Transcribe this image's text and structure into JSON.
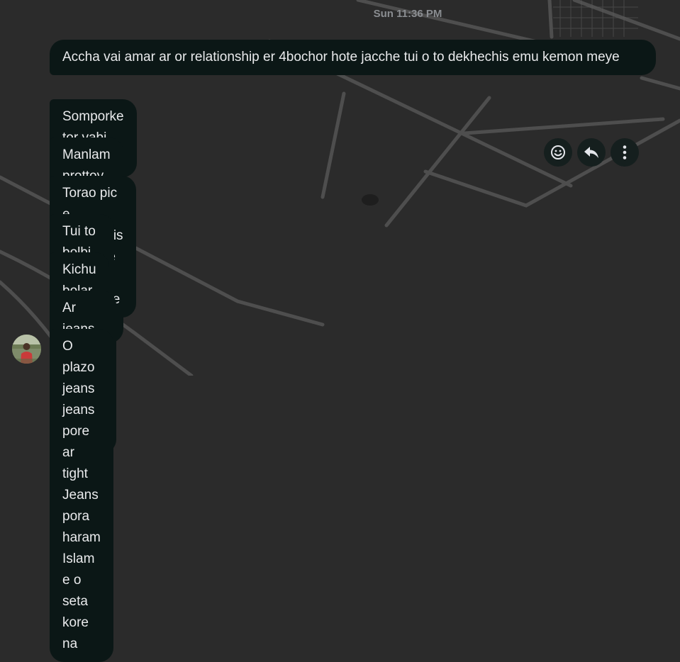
{
  "conversation": {
    "timestamp": "Sun 11:36 PM",
    "messages": [
      {
        "text": "Accha vai amar ar or relationship er 4bochor hote jacche tui o to dekhechis emu kemon meye"
      },
      {
        "text": "Somporke tor vabi hoi"
      },
      {
        "text": "Manlam prottoy boleche tui bolte parti na je emu valo or dressup kemon"
      },
      {
        "text": "Torao pic e dekhechis oi kivabe chola Fera kore"
      },
      {
        "text": "Tui to bolbi na ulta aro eisob niye gossip e korbi"
      },
      {
        "text": "Kichu bolar nai vai"
      },
      {
        "text": "Ar jeans er kotha jeita bolchili tora"
      },
      {
        "text": "O plazo jeans jeans pore ar tight Jeans pora haram Islam e o seta kore na"
      }
    ]
  },
  "message_actions": {
    "icons": [
      "emoji-icon",
      "reply-icon",
      "more-icon"
    ]
  },
  "colors": {
    "background": "#2b2b2b",
    "bubble": "#0b1716",
    "text": "#e9eaec",
    "timestamp": "#8a8d91"
  }
}
